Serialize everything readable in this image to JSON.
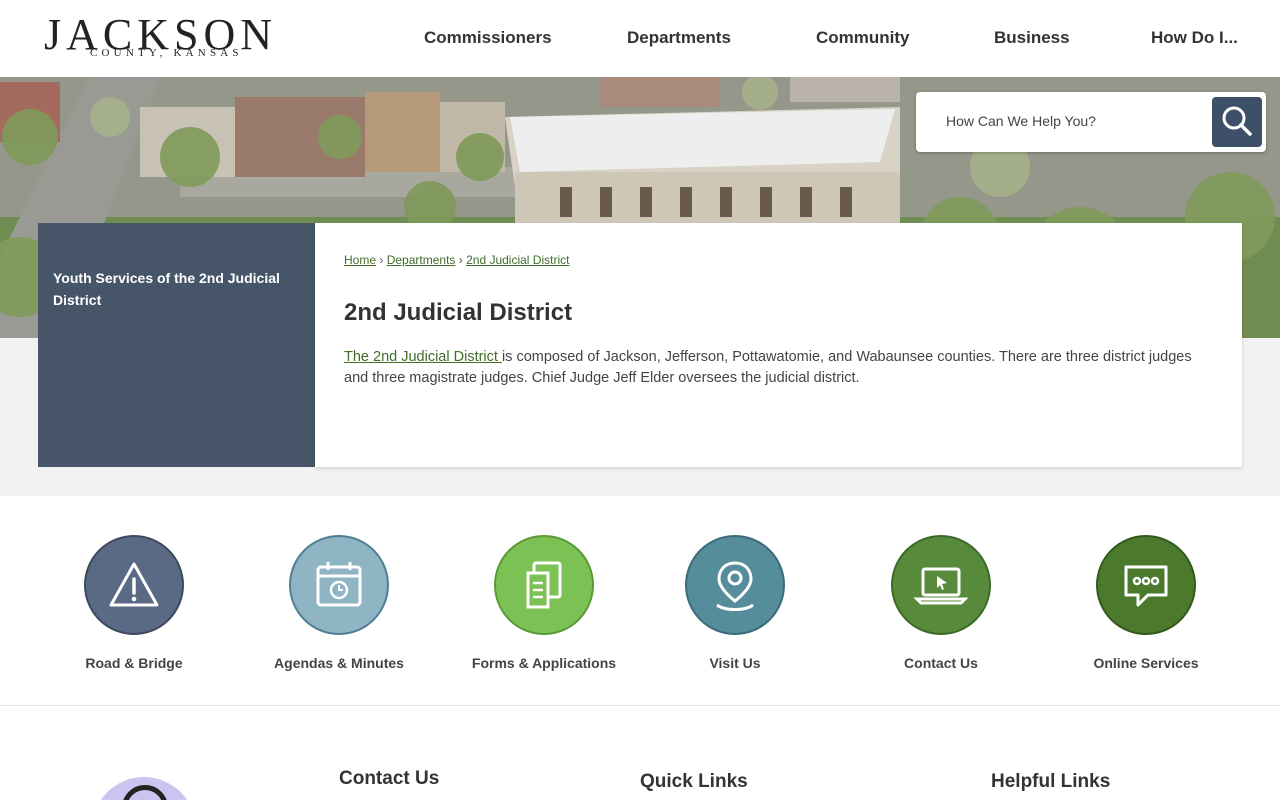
{
  "logo": {
    "main": "JACKSON",
    "sub": "COUNTY, KANSAS"
  },
  "nav": {
    "items": [
      {
        "label": "Commissioners"
      },
      {
        "label": "Departments"
      },
      {
        "label": "Community"
      },
      {
        "label": "Business"
      },
      {
        "label": "How Do I..."
      }
    ]
  },
  "search": {
    "placeholder": "How Can We Help You?",
    "value": ""
  },
  "sidebar": {
    "link": "Youth Services of the 2nd Judicial District"
  },
  "breadcrumb": {
    "home": "Home",
    "sep": "›",
    "departments": "Departments",
    "current": "2nd Judicial District"
  },
  "page": {
    "title": "2nd Judicial District",
    "link_text": "The 2nd Judicial District ",
    "body": "is composed of Jackson, Jefferson, Pottawatomie, and Wabaunsee counties. There are three district judges and three magistrate judges. Chief Judge Jeff Elder oversees the judicial district."
  },
  "quick_links": [
    {
      "label": "Road & Bridge",
      "icon": "warning-icon",
      "color": "#5a6a84"
    },
    {
      "label": "Agendas & Minutes",
      "icon": "calendar-icon",
      "color": "#8fb4c4"
    },
    {
      "label": "Forms & Applications",
      "icon": "documents-icon",
      "color": "#7cc153"
    },
    {
      "label": "Visit Us",
      "icon": "location-pin-icon",
      "color": "#568d9b"
    },
    {
      "label": "Contact Us",
      "icon": "laptop-cursor-icon",
      "color": "#578a3a"
    },
    {
      "label": "Online Services",
      "icon": "chat-bubble-icon",
      "color": "#4b7a2c"
    }
  ],
  "footer": {
    "contact_heading": "Contact Us",
    "quick_heading": "Quick Links",
    "helpful_heading": "Helpful Links"
  },
  "colors": {
    "nav_dark": "#475569",
    "search_button": "#3d5068",
    "link_green": "#3f6e2a"
  }
}
